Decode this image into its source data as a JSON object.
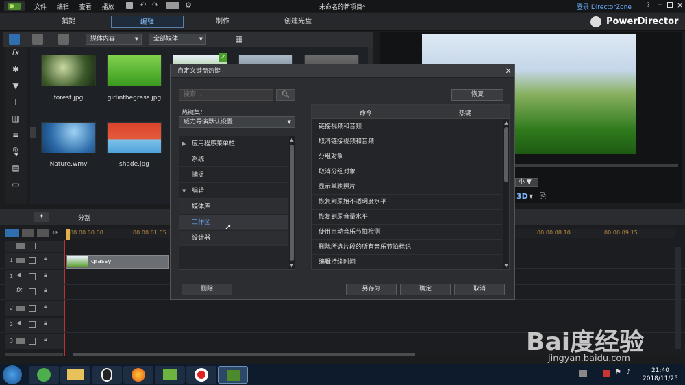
{
  "menubar": {
    "items": [
      "文件",
      "编辑",
      "查看",
      "播放"
    ]
  },
  "title": "未命名的新项目*",
  "login": "登录 DirectorZone",
  "help": "?",
  "brand": "PowerDirector",
  "modes": [
    "捕捉",
    "编辑",
    "制作",
    "创建光盘"
  ],
  "library": {
    "dropdown1": "媒体内容",
    "dropdown2": "全部媒体",
    "items": [
      {
        "name": "forest.jpg"
      },
      {
        "name": "girlinthegrass.jpg"
      },
      {
        "name": "Nature.wmv"
      },
      {
        "name": "shade.jpg"
      }
    ]
  },
  "tlbar": {
    "split": "分割"
  },
  "timeline": {
    "ruler": [
      "00:00:00:00",
      "00:00:01:05",
      "00:00:08:10",
      "00:00:09:15"
    ],
    "clip": "grassy",
    "tracks": [
      "1.",
      "1.",
      "fx",
      "2.",
      "2.",
      "3."
    ]
  },
  "preview": {
    "size_label": "小",
    "mode3d": "3D"
  },
  "dialog": {
    "title": "自定义键盘热键",
    "search_placeholder": "搜索...",
    "hotkey_set_label": "热键集：",
    "hotkey_set_value": "威力导演默认设置",
    "restore": "恢复",
    "col_command": "命令",
    "col_hotkey": "热键",
    "categories": [
      {
        "label": "应用程序菜单栏",
        "arrow": "▶"
      },
      {
        "label": "系统",
        "arrow": ""
      },
      {
        "label": "捕捉",
        "arrow": ""
      },
      {
        "label": "编辑",
        "arrow": "▼"
      },
      {
        "label": "媒体库",
        "arrow": ""
      },
      {
        "label": "工作区",
        "arrow": ""
      },
      {
        "label": "设计器",
        "arrow": ""
      }
    ],
    "commands": [
      "链接视频和音频",
      "取消链接视频和音频",
      "分组对象",
      "取消分组对象",
      "显示单独照片",
      "恢复到原始不透明度水平",
      "恢复到原音量水平",
      "使用自动音乐节拍检测",
      "删除所选片段的所有音乐节拍标记",
      "编辑持续时间"
    ],
    "delete": "删除",
    "save_as": "另存为",
    "ok": "确定",
    "cancel": "取消"
  },
  "taskbar": {
    "time": "21:40",
    "date": "2018/11/25"
  },
  "watermark": {
    "brand": "Bai度经验",
    "url": "jingyan.baidu.com"
  }
}
